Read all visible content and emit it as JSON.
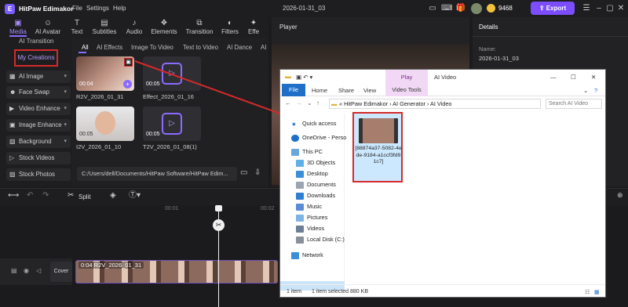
{
  "app": {
    "name": "HitPaw Edimakor",
    "menus": [
      "File",
      "Settings",
      "Help"
    ],
    "project": "2026-01-31_03",
    "coins": "9468",
    "export_label": "Export"
  },
  "colors": {
    "accent": "#7c4dff",
    "highlight": "#d42a2a",
    "explorer_blue": "#1f6fc9"
  },
  "tabs": [
    {
      "label": "Media",
      "icon": "media-icon"
    },
    {
      "label": "AI Avatar",
      "icon": "avatar-icon"
    },
    {
      "label": "Text",
      "icon": "text-icon"
    },
    {
      "label": "Subtitles",
      "icon": "subtitles-icon"
    },
    {
      "label": "Audio",
      "icon": "audio-icon"
    },
    {
      "label": "Elements",
      "icon": "elements-icon"
    },
    {
      "label": "Transition",
      "icon": "transition-icon"
    },
    {
      "label": "Filters",
      "icon": "filters-icon"
    },
    {
      "label": "Effe",
      "icon": "effects-icon"
    }
  ],
  "sidebar": {
    "ai_transition": "AI Transition",
    "my_creations": "My Creations",
    "items": [
      {
        "label": "AI Image",
        "icon": "image-icon"
      },
      {
        "label": "Face Swap",
        "icon": "face-swap-icon"
      },
      {
        "label": "Video Enhance",
        "icon": "enhance-icon"
      },
      {
        "label": "Image Enhance",
        "icon": "enhance-icon"
      },
      {
        "label": "Background",
        "icon": "background-icon"
      },
      {
        "label": "Stock Videos",
        "icon": "stock-video-icon"
      },
      {
        "label": "Stock Photos",
        "icon": "stock-photo-icon"
      }
    ]
  },
  "subtabs": [
    "All",
    "AI Effects",
    "Image To Video",
    "Text to Video",
    "AI Dance",
    "AI"
  ],
  "media": [
    {
      "name": "R2V_2026_01_31",
      "duration": "00:04"
    },
    {
      "name": "Effect_2026_01_16",
      "duration": "00:05"
    },
    {
      "name": "I2V_2026_01_10",
      "duration": "00:05"
    },
    {
      "name": "T2V_2026_01_08(1)",
      "duration": "00:05"
    }
  ],
  "path": "C:/Users/dell/Documents/HitPaw Software/HitPaw Edim...",
  "player": {
    "label": "Player"
  },
  "details": {
    "tab": "Details",
    "name_label": "Name:",
    "name_value": "2026-01-31_03"
  },
  "timeline": {
    "split_label": "Split",
    "ruler": [
      "00:01",
      "00:02"
    ],
    "cover_label": "Cover",
    "clip_label": "0:04  R2V_2026_01_31"
  },
  "explorer": {
    "title": "AI Video",
    "play_tab": "Play",
    "ribbon": [
      "File",
      "Home",
      "Share",
      "View",
      "Video Tools"
    ],
    "breadcrumb": [
      "HitPaw Edimakor",
      "AI Generator",
      "AI Video"
    ],
    "search_placeholder": "Search AI Video",
    "nav": [
      "Quick access",
      "OneDrive - Perso",
      "This PC",
      "3D Objects",
      "Desktop",
      "Documents",
      "Downloads",
      "Music",
      "Pictures",
      "Videos",
      "Local Disk (C:)",
      "Network"
    ],
    "file_name": "[88874a37-5082-4ede-9184-a1ccf3fd91c7]",
    "status_items": "1 item",
    "status_selected": "1 item selected  880 KB"
  }
}
